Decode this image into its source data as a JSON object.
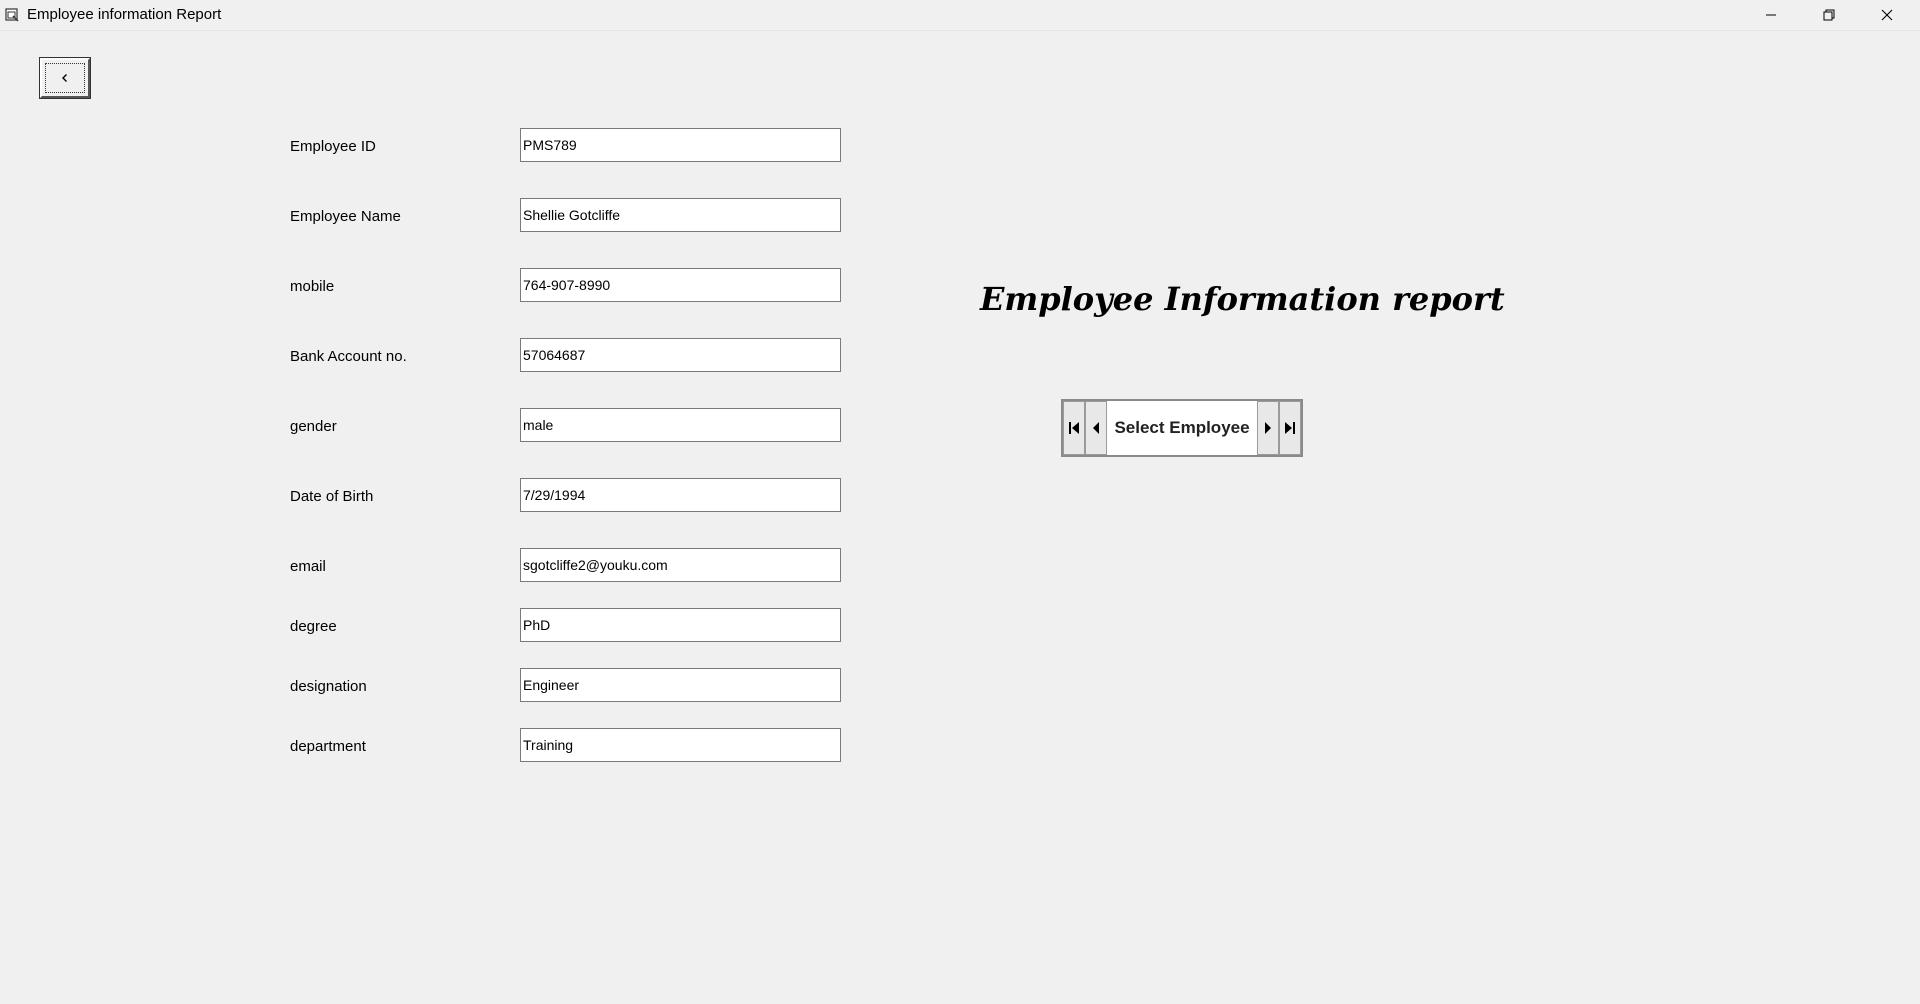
{
  "window": {
    "title": "Employee information Report",
    "icons": [
      "app-icon",
      "minimize-icon",
      "restore-icon",
      "close-icon"
    ]
  },
  "back_button": {
    "icon": "chevron-left-icon"
  },
  "form": {
    "fields": [
      {
        "label": "Employee ID",
        "value": "PMS789"
      },
      {
        "label": "Employee Name",
        "value": "Shellie Gotcliffe"
      },
      {
        "label": "mobile",
        "value": "764-907-8990"
      },
      {
        "label": "Bank Account no.",
        "value": "57064687"
      },
      {
        "label": "gender",
        "value": "male"
      },
      {
        "label": "Date of Birth",
        "value": "7/29/1994"
      },
      {
        "label": "email",
        "value": "sgotcliffe2@youku.com"
      },
      {
        "label": "degree",
        "value": "PhD"
      },
      {
        "label": "designation",
        "value": "Engineer"
      },
      {
        "label": "department",
        "value": "Training"
      }
    ]
  },
  "report": {
    "heading": "Employee Information report"
  },
  "navigator": {
    "caption": "Select Employee",
    "icons": [
      "first-record-icon",
      "previous-record-icon",
      "next-record-icon",
      "last-record-icon"
    ]
  }
}
